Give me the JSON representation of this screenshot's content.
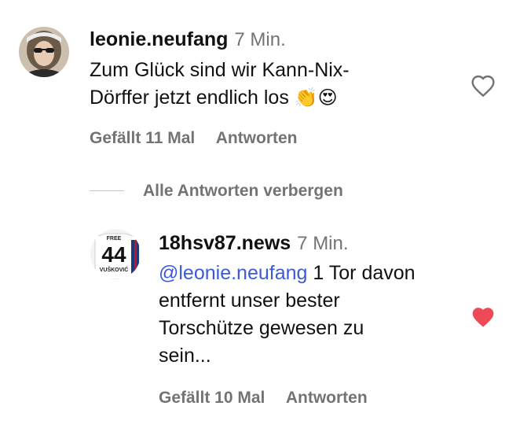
{
  "comment": {
    "username": "leonie.neufang",
    "time": "7 Min.",
    "text_line1": "Zum Glück sind wir Kann-Nix-",
    "text_line2": "Dörffer jetzt endlich los",
    "emojis": "👏😍",
    "likes": "Gefällt 11 Mal",
    "reply": "Antworten",
    "liked": false
  },
  "toggle_replies": "Alle Antworten verbergen",
  "reply_comment": {
    "username": "18hsv87.news",
    "time": "7 Min.",
    "mention": "@leonie.neufang",
    "text_line1_rest": " 1 Tor davon",
    "text_line2": "entfernt unser bester",
    "text_line3": "Torschütze gewesen zu",
    "text_line4": "sein...",
    "likes": "Gefällt 10 Mal",
    "reply": "Antworten",
    "liked": true,
    "avatar_text_top": "FREE",
    "avatar_number": "44",
    "avatar_name": "VUŠKOVIĆ"
  },
  "colors": {
    "like_red": "#ed4956",
    "mention_blue": "#3b5bdb",
    "meta_gray": "#737373"
  }
}
